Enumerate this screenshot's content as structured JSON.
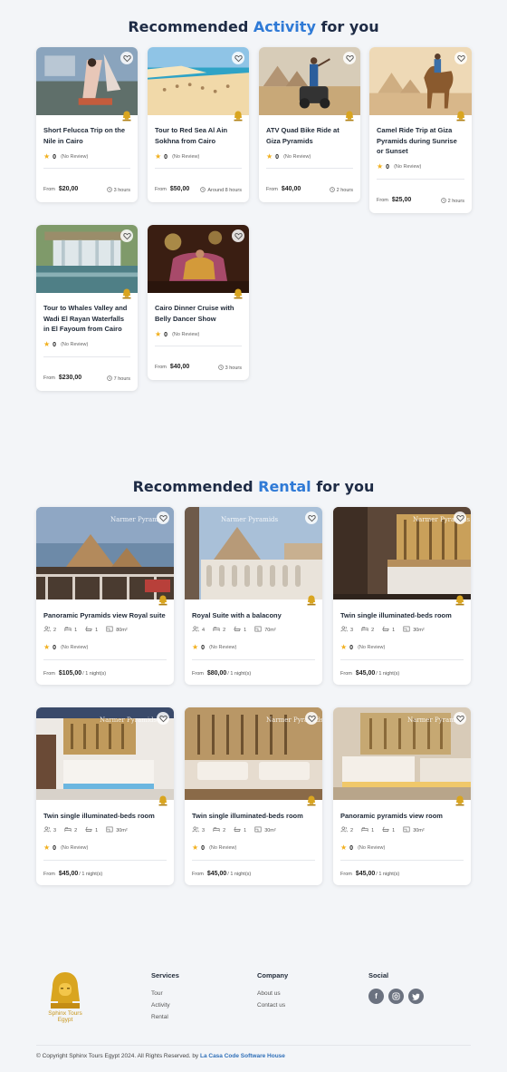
{
  "activity_section": {
    "title_pre": "Recommended ",
    "title_hl": "Activity",
    "title_post": " for you"
  },
  "rental_section": {
    "title_pre": "Recommended ",
    "title_hl": "Rental",
    "title_post": " for you"
  },
  "activities": [
    {
      "title": "Short Felucca Trip on the Nile in Cairo",
      "rating": "0",
      "reviews": "(No Review)",
      "from": "From",
      "price": "$20,00",
      "duration": "3 hours"
    },
    {
      "title": "Tour to Red Sea Al Ain Sokhna from Cairo",
      "rating": "0",
      "reviews": "(No Review)",
      "from": "From",
      "price": "$50,00",
      "duration": "Around 8 hours"
    },
    {
      "title": "ATV Quad Bike Ride at Giza Pyramids",
      "rating": "0",
      "reviews": "(No Review)",
      "from": "From",
      "price": "$40,00",
      "duration": "2 hours"
    },
    {
      "title": "Camel Ride Trip at Giza Pyramids during Sunrise or Sunset",
      "rating": "0",
      "reviews": "(No Review)",
      "from": "From",
      "price": "$25,00",
      "duration": "2 hours"
    },
    {
      "title": "Tour to Whales Valley and Wadi El Rayan Waterfalls in El Fayoum from Cairo",
      "rating": "0",
      "reviews": "(No Review)",
      "from": "From",
      "price": "$230,00",
      "duration": "7 hours"
    },
    {
      "title": "Cairo Dinner Cruise with Belly Dancer Show",
      "rating": "0",
      "reviews": "(No Review)",
      "from": "From",
      "price": "$40,00",
      "duration": "3 hours"
    }
  ],
  "rentals": [
    {
      "title": "Panoramic Pyramids view Royal suite",
      "guests": "2",
      "beds": "1",
      "baths": "1",
      "area": "80m²",
      "rating": "0",
      "reviews": "(No Review)",
      "from": "From",
      "price": "$105,00",
      "unit": "/ 1 night(s)",
      "watermark": "Narmer Pyramids"
    },
    {
      "title": "Royal Suite with a balacony",
      "guests": "4",
      "beds": "2",
      "baths": "1",
      "area": "70m²",
      "rating": "0",
      "reviews": "(No Review)",
      "from": "From",
      "price": "$80,00",
      "unit": "/ 1 night(s)",
      "watermark": "Narmer Pyramids"
    },
    {
      "title": "Twin single illuminated-beds room",
      "guests": "3",
      "beds": "2",
      "baths": "1",
      "area": "30m²",
      "rating": "0",
      "reviews": "(No Review)",
      "from": "From",
      "price": "$45,00",
      "unit": "/ 1 night(s)",
      "watermark": "Narmer Pyramids"
    },
    {
      "title": "Twin single illuminated-beds room",
      "guests": "3",
      "beds": "2",
      "baths": "1",
      "area": "30m²",
      "rating": "0",
      "reviews": "(No Review)",
      "from": "From",
      "price": "$45,00",
      "unit": "/ 1 night(s)",
      "watermark": "Narmer Pyramids"
    },
    {
      "title": "Twin single illuminated-beds room",
      "guests": "3",
      "beds": "2",
      "baths": "1",
      "area": "30m²",
      "rating": "0",
      "reviews": "(No Review)",
      "from": "From",
      "price": "$45,00",
      "unit": "/ 1 night(s)",
      "watermark": "Narmer Pyramids"
    },
    {
      "title": "Panoramic pyramids view room",
      "guests": "2",
      "beds": "1",
      "baths": "1",
      "area": "30m²",
      "rating": "0",
      "reviews": "(No Review)",
      "from": "From",
      "price": "$45,00",
      "unit": "/ 1 night(s)",
      "watermark": "Narmer Pyramids"
    }
  ],
  "footer": {
    "logo_text": "Sphinx Tours Egypt",
    "services": {
      "heading": "Services",
      "links": [
        "Tour",
        "Activity",
        "Rental"
      ]
    },
    "company": {
      "heading": "Company",
      "links": [
        "About us",
        "Contact us"
      ]
    },
    "social": {
      "heading": "Social",
      "icons": [
        "facebook-icon",
        "instagram-icon",
        "twitter-icon"
      ]
    },
    "copyright": "© Copyright Sphinx Tours Egypt 2024. All Rights Reserved. by ",
    "copyright_link": "La Casa Code Software House"
  },
  "colors": {
    "accent": "#2f7ad6",
    "heading": "#1e2b45",
    "star": "#f2b01e",
    "gold": "#c9961a"
  }
}
